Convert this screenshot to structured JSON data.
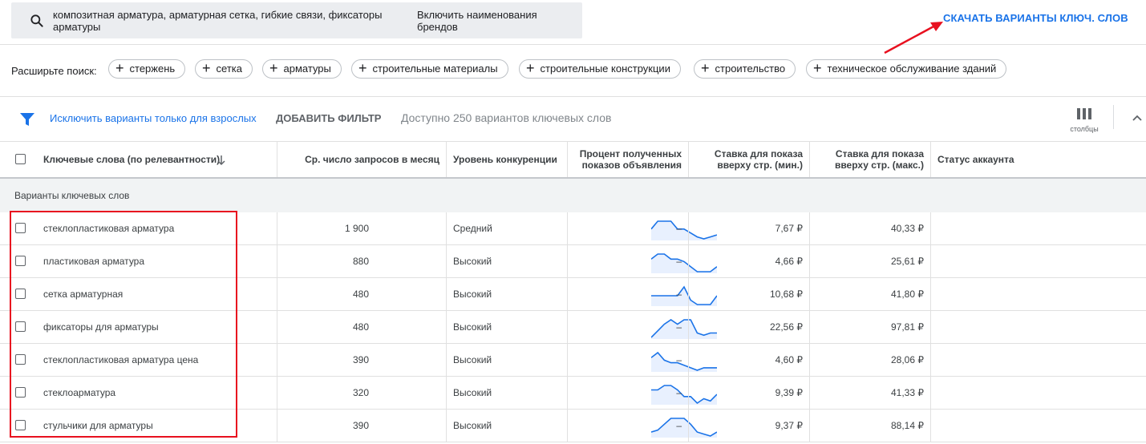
{
  "search": {
    "query": "композитная арматура, арматурная сетка, гибкие связи, фиксаторы арматуры",
    "brands_toggle": "Включить наименования брендов"
  },
  "download_label": "СКАЧАТЬ ВАРИАНТЫ КЛЮЧ. СЛОВ",
  "expand": {
    "label": "Расширьте поиск:",
    "chips": [
      "стержень",
      "сетка",
      "арматуры",
      "строительные материалы",
      "строительные конструкции",
      "строительство",
      "техническое обслуживание зданий"
    ]
  },
  "filters": {
    "adult": "Исключить варианты только для взрослых",
    "add_filter": "ДОБАВИТЬ ФИЛЬТР",
    "available": "Доступно 250 вариантов ключевых слов",
    "columns_label": "столбцы"
  },
  "table": {
    "headers": {
      "keyword": "Ключевые слова (по релевантности)",
      "searches": "Ср. число запросов в месяц",
      "competition": "Уровень конкуренции",
      "impr_share": "Процент полученных показов объявления",
      "bid_low": "Ставка для показа вверху стр. (мин.)",
      "bid_high": "Ставка для показа вверху стр. (макс.)",
      "status": "Статус аккаунта"
    },
    "section_label": "Варианты ключевых слов",
    "rows": [
      {
        "keyword": "стеклопластиковая арматура",
        "searches": "1 900",
        "trend": [
          5,
          9,
          9,
          9,
          5,
          5,
          3,
          1,
          0,
          1,
          2
        ],
        "competition": "Средний",
        "impr_share": "–",
        "bid_low": "7,67 ₽",
        "bid_high": "40,33 ₽"
      },
      {
        "keyword": "пластиковая арматура",
        "searches": "880",
        "trend": [
          7,
          9,
          9,
          7,
          7,
          6,
          4,
          2,
          2,
          2,
          4
        ],
        "competition": "Высокий",
        "impr_share": "–",
        "bid_low": "4,66 ₽",
        "bid_high": "25,61 ₽"
      },
      {
        "keyword": "сетка арматурная",
        "searches": "480",
        "trend": [
          4,
          4,
          4,
          4,
          4,
          6,
          3,
          2,
          2,
          2,
          4
        ],
        "competition": "Высокий",
        "impr_share": "–",
        "bid_low": "10,68 ₽",
        "bid_high": "41,80 ₽"
      },
      {
        "keyword": "фиксаторы для арматуры",
        "searches": "480",
        "trend": [
          1,
          4,
          7,
          9,
          7,
          9,
          9,
          3,
          2,
          3,
          3
        ],
        "competition": "Высокий",
        "impr_share": "–",
        "bid_low": "22,56 ₽",
        "bid_high": "97,81 ₽"
      },
      {
        "keyword": "стеклопластиковая арматура цена",
        "searches": "390",
        "trend": [
          7,
          9,
          6,
          5,
          5,
          4,
          3,
          2,
          3,
          3,
          3
        ],
        "competition": "Высокий",
        "impr_share": "–",
        "bid_low": "4,60 ₽",
        "bid_high": "28,06 ₽"
      },
      {
        "keyword": "стеклоарматура",
        "searches": "320",
        "trend": [
          6,
          6,
          8,
          8,
          6,
          3,
          3,
          0,
          2,
          1,
          4
        ],
        "competition": "Высокий",
        "impr_share": "–",
        "bid_low": "9,39 ₽",
        "bid_high": "41,33 ₽"
      },
      {
        "keyword": "стульчики для арматуры",
        "searches": "390",
        "trend": [
          2,
          3,
          6,
          9,
          9,
          9,
          6,
          2,
          1,
          0,
          2
        ],
        "competition": "Высокий",
        "impr_share": "–",
        "bid_low": "9,37 ₽",
        "bid_high": "88,14 ₽"
      }
    ]
  },
  "colors": {
    "accent": "#1a73e8",
    "highlight": "#e8101f",
    "spark_fill": "#e8f0fe"
  }
}
